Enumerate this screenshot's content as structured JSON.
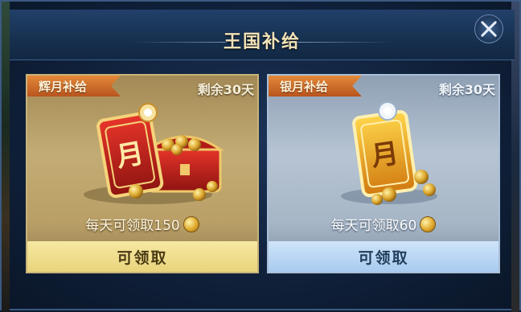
{
  "window": {
    "title": "王国补给"
  },
  "cards": [
    {
      "tier_label": "辉月补给",
      "remaining": "剩余30天",
      "daily_text": "每天可领取150",
      "claim_label": "可领取",
      "emblem_glyph": "月",
      "icon": "gold-coin-icon",
      "theme": "gold",
      "colors": {
        "accent": "#c9b37a"
      }
    },
    {
      "tier_label": "银月补给",
      "remaining": "剩余30天",
      "daily_text": "每天可领取60",
      "claim_label": "可领取",
      "emblem_glyph": "月",
      "icon": "gold-coin-icon",
      "theme": "silver",
      "colors": {
        "accent": "#a9bfd8"
      }
    }
  ]
}
